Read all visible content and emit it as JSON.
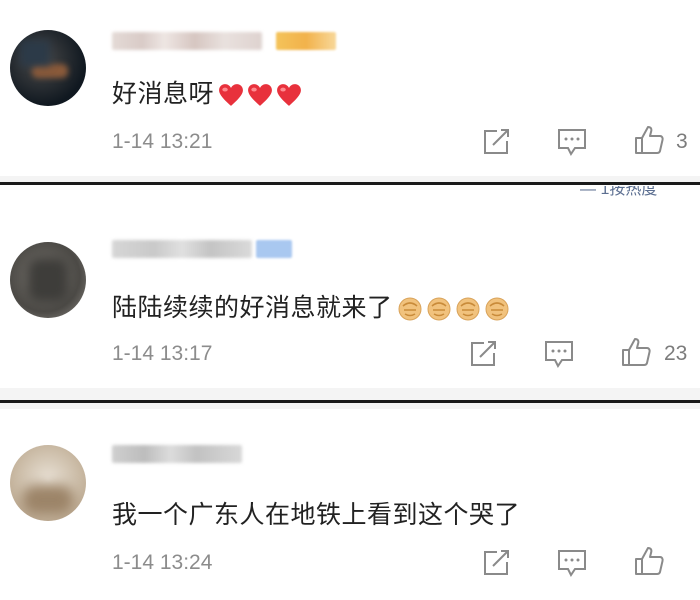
{
  "comments": [
    {
      "text": "好消息呀",
      "emoji": [
        "heart-icon",
        "heart-icon",
        "heart-icon"
      ],
      "time": "1-14 13:21",
      "likes": "3"
    },
    {
      "text": "陆陆续续的好消息就来了",
      "emoji": [
        "fist-icon",
        "fist-icon",
        "fist-icon",
        "fist-icon"
      ],
      "time": "1-14 13:17",
      "likes": "23"
    },
    {
      "text": "我一个广东人在地铁上看到这个哭了",
      "emoji": [],
      "time": "1-14 13:24",
      "likes": ""
    }
  ],
  "sort_header_partial": "按热度",
  "colors": {
    "text": "#222222",
    "meta": "#8c8c8c",
    "heart": "#e8313c",
    "fist": "#f1c27d",
    "divider": "#1a1a1a"
  }
}
